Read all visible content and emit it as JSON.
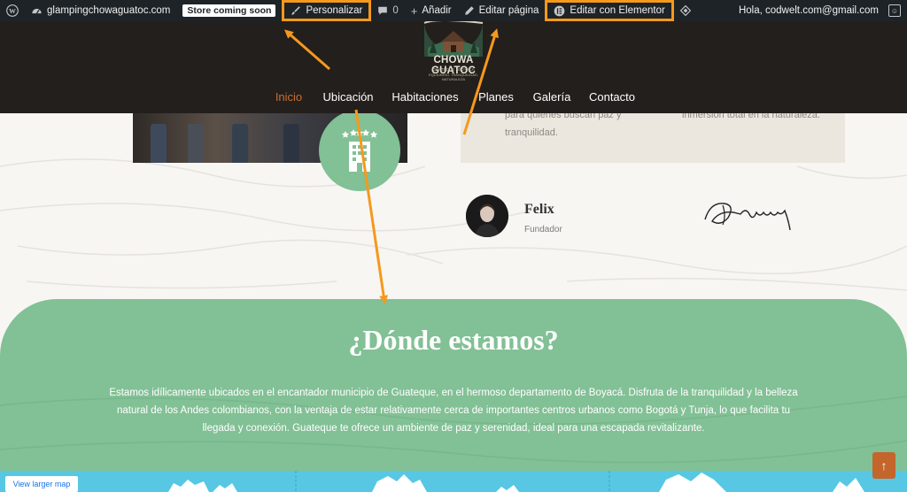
{
  "adminbar": {
    "site_name": "glampingchowaguatoc.com",
    "store_badge": "Store coming soon",
    "customize_label": "Personalizar",
    "comments_count": "0",
    "add_new_label": "Añadir",
    "edit_page_label": "Editar página",
    "elementor_label": "Editar con Elementor",
    "greeting": "Hola, codwelt.com@gmail.com",
    "icons": {
      "wp": "wordpress-icon",
      "dashboard": "dashboard-icon",
      "brush": "brush-icon",
      "comment": "comment-icon",
      "plus": "plus-icon",
      "pencil": "pencil-icon",
      "elementor": "elementor-icon",
      "diamond": "diamond-icon",
      "avatar": "user-avatar-icon"
    }
  },
  "header": {
    "logo": {
      "name": "CHOWA GUATOC",
      "location": "GUATEQUE · BOYACÁ",
      "tagline": "EQUILIBRIO, TRANQUILIDAD, NATURALEZA"
    },
    "nav": [
      "Inicio",
      "Ubicación",
      "Habitaciones",
      "Planes",
      "Galería",
      "Contacto"
    ],
    "active_nav": "Inicio"
  },
  "content": {
    "card_left_text": [
      "para quienes buscan paz y",
      "tranquilidad."
    ],
    "card_right_text": [
      "inmersión total en la naturaleza."
    ],
    "person": {
      "name": "Felix",
      "role": "Fundador"
    },
    "section": {
      "title": "¿Dónde estamos?",
      "description": "Estamos idílicamente ubicados en el encantador municipio de Guateque, en el hermoso departamento de Boyacá. Disfruta de la tranquilidad y la belleza natural de los Andes colombianos, con la ventaja de estar relativamente cerca de importantes centros urbanos como Bogotá y Tunja, lo que facilita tu llegada y conexión. Guateque te ofrece un ambiente de paz y serenidad, ideal para una escapada revitalizante."
    },
    "map_link": "View larger map",
    "scroll_top_icon": "arrow-up-icon",
    "badge_icon": "hotel-building-icon"
  },
  "colors": {
    "admin_bar": "#1d2327",
    "header_bg": "#231f1c",
    "active_nav": "#c76f35",
    "green": "#82c095",
    "highlight": "#f5991d",
    "map_water": "#57c7e3",
    "scroll_button": "#c4652c"
  }
}
